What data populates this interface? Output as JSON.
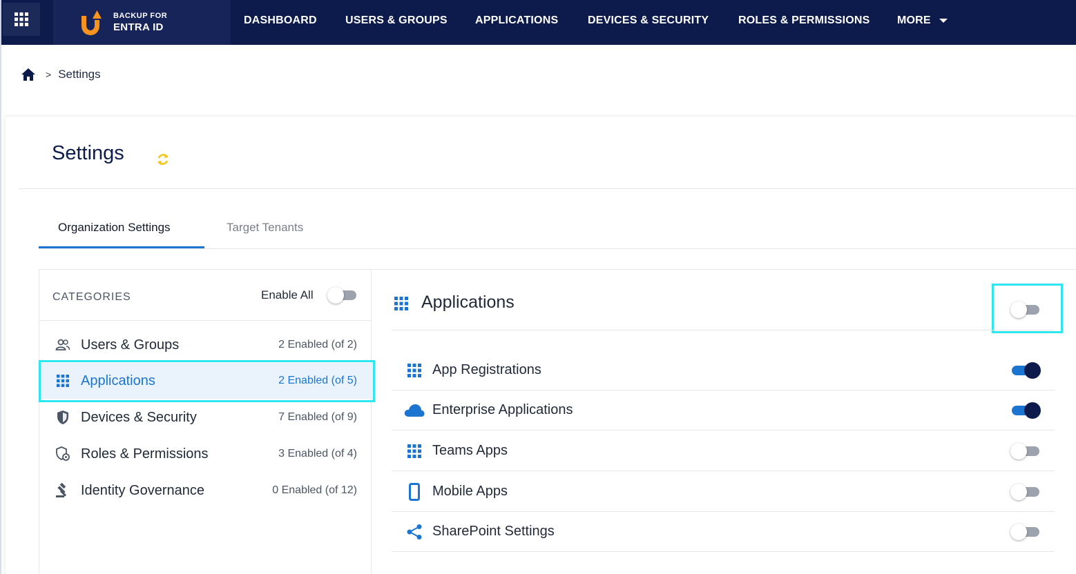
{
  "nav": {
    "brand_line1": "BACKUP FOR",
    "brand_line2": "ENTRA ID",
    "items": [
      {
        "label": "DASHBOARD"
      },
      {
        "label": "USERS & GROUPS"
      },
      {
        "label": "APPLICATIONS"
      },
      {
        "label": "DEVICES & SECURITY"
      },
      {
        "label": "ROLES & PERMISSIONS"
      },
      {
        "label": "MORE"
      }
    ]
  },
  "breadcrumb": {
    "separator": ">",
    "current": "Settings"
  },
  "page": {
    "title": "Settings"
  },
  "tabs": [
    {
      "label": "Organization Settings",
      "active": true
    },
    {
      "label": "Target Tenants",
      "active": false
    }
  ],
  "categories": {
    "header": "CATEGORIES",
    "enable_all_label": "Enable All",
    "enable_all_on": false,
    "items": [
      {
        "label": "Users & Groups",
        "count": "2 Enabled (of 2)",
        "icon": "users-icon",
        "selected": false
      },
      {
        "label": "Applications",
        "count": "2 Enabled (of 5)",
        "icon": "grid-icon",
        "selected": true
      },
      {
        "label": "Devices & Security",
        "count": "7 Enabled (of 9)",
        "icon": "shield-icon",
        "selected": false
      },
      {
        "label": "Roles & Permissions",
        "count": "3 Enabled (of 4)",
        "icon": "shield-settings-icon",
        "selected": false
      },
      {
        "label": "Identity Governance",
        "count": "0 Enabled (of 12)",
        "icon": "gavel-icon",
        "selected": false
      }
    ]
  },
  "applications": {
    "title": "Applications",
    "master_toggle_on": false,
    "items": [
      {
        "label": "App Registrations",
        "icon": "grid-icon",
        "enabled": true
      },
      {
        "label": "Enterprise Applications",
        "icon": "cloud-icon",
        "enabled": true
      },
      {
        "label": "Teams Apps",
        "icon": "grid-icon",
        "enabled": false
      },
      {
        "label": "Mobile Apps",
        "icon": "mobile-icon",
        "enabled": false
      },
      {
        "label": "SharePoint Settings",
        "icon": "share-icon",
        "enabled": false
      }
    ]
  },
  "colors": {
    "nav_bg": "#0d1b4c",
    "accent": "#1b75d0",
    "brand_orange": "#f7931e",
    "highlight": "#2ee6ef",
    "refresh_yellow": "#f5c518"
  }
}
